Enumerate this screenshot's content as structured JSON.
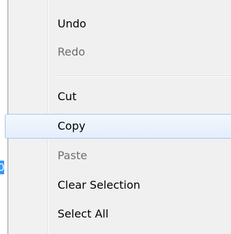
{
  "editor": {
    "selected_text_fragment": "0"
  },
  "context_menu": {
    "items": [
      {
        "label": "Undo",
        "enabled": true
      },
      {
        "label": "Redo",
        "enabled": false
      },
      {
        "label": "Cut",
        "enabled": true
      },
      {
        "label": "Copy",
        "enabled": true,
        "highlighted": true
      },
      {
        "label": "Paste",
        "enabled": false
      },
      {
        "label": "Clear Selection",
        "enabled": true
      },
      {
        "label": "Select All",
        "enabled": true
      }
    ]
  },
  "colors": {
    "menu_background": "#f0f0f0",
    "highlight_border": "#a8c8ea",
    "highlight_fill": "#e8f1fc",
    "disabled_text": "#6d6d6d",
    "selection_background": "#3399ff"
  }
}
